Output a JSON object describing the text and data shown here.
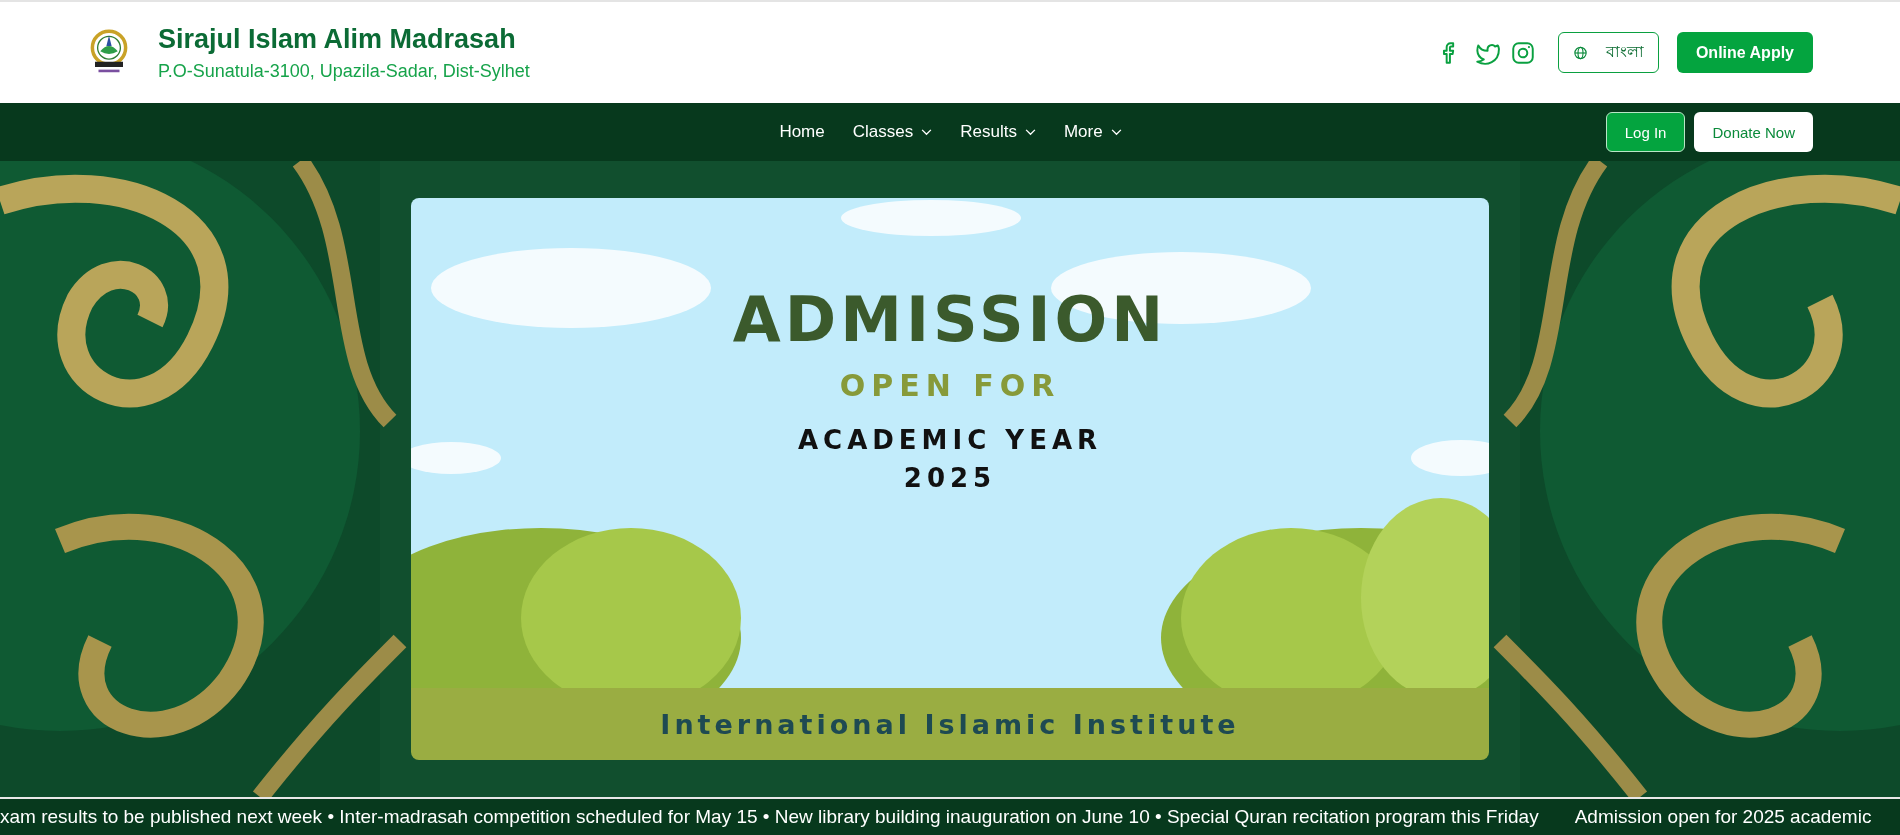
{
  "header": {
    "title": "Sirajul Islam Alim Madrasah",
    "address": "P.O-Sunatula-3100, Upazila-Sadar, Dist-Sylhet"
  },
  "social_links": [
    {
      "kind": "facebook"
    },
    {
      "kind": "twitter"
    },
    {
      "kind": "instagram"
    }
  ],
  "language_button": {
    "label": "বাংলা"
  },
  "apply_button": {
    "label": "Online Apply"
  },
  "nav": {
    "items": [
      {
        "label": "Home",
        "dropdown": false
      },
      {
        "label": "Classes",
        "dropdown": true
      },
      {
        "label": "Results",
        "dropdown": true
      },
      {
        "label": "More",
        "dropdown": true
      }
    ]
  },
  "login_button": {
    "label": "Log In"
  },
  "donate_button": {
    "label": "Donate Now"
  },
  "banner": {
    "headline": "ADMISSION",
    "subhead": "OPEN FOR",
    "line_1": "ACADEMIC YEAR",
    "line_2": "2025",
    "footer": "International Islamic Institute"
  },
  "ticker": {
    "items": [
      "xam results to be published next week • Inter-madrasah competition scheduled for May 15 • New library building inauguration on June 10 • Special Quran recitation program this Friday",
      "Admission open for 2025 academic"
    ]
  }
}
